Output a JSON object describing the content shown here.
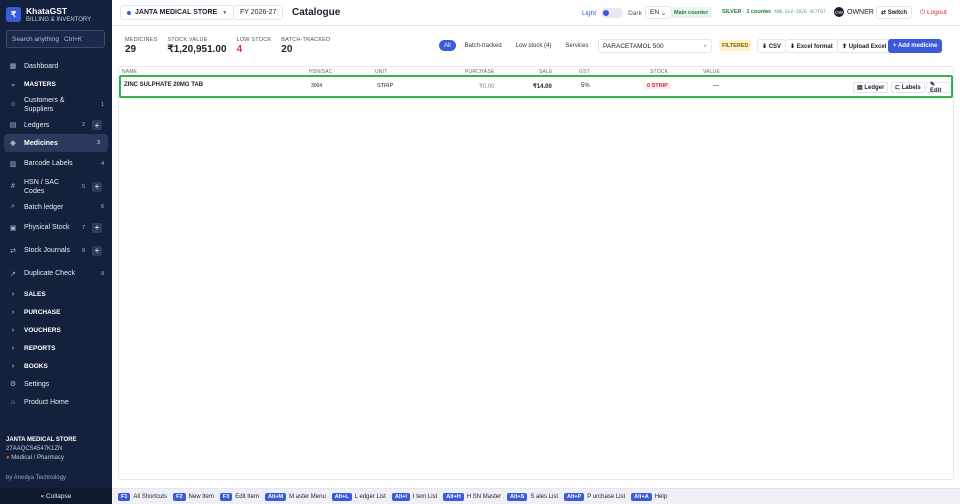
{
  "app": {
    "name": "KhataGST",
    "subtitle": "BILLING & INVENTORY",
    "logo_glyph": "₹"
  },
  "search": {
    "placeholder": "Search anything",
    "shortcut": "Ctrl+K"
  },
  "sidebar": {
    "items": [
      {
        "label": "Dashboard",
        "icon": "dashboard-icon"
      },
      {
        "label": "MASTERS",
        "section": true,
        "icon": "chevron-down-icon"
      },
      {
        "label": "Customers & Suppliers",
        "count": "1",
        "icon": "users-icon"
      },
      {
        "label": "Ledgers",
        "count": "2",
        "plus": true,
        "icon": "book-icon"
      },
      {
        "label": "Medicines",
        "count": "3",
        "active": true,
        "icon": "pill-icon"
      },
      {
        "label": "Barcode Labels",
        "count": "4",
        "icon": "barcode-icon"
      },
      {
        "label": "HSN / SAC Codes",
        "count": "5",
        "plus": true,
        "icon": "hash-icon"
      },
      {
        "label": "Batch ledger",
        "count": "6",
        "icon": "search-icon"
      },
      {
        "label": "Physical Stock",
        "count": "7",
        "plus": true,
        "icon": "box-icon"
      },
      {
        "label": "Stock Journals",
        "count": "8",
        "plus": true,
        "icon": "arrows-icon"
      },
      {
        "label": "Duplicate Check",
        "count": "9",
        "icon": "wand-icon"
      },
      {
        "label": "SALES",
        "section": true,
        "icon": "chevron-right-icon"
      },
      {
        "label": "PURCHASE",
        "section": true,
        "icon": "chevron-right-icon"
      },
      {
        "label": "VOUCHERS",
        "section": true,
        "icon": "chevron-right-icon"
      },
      {
        "label": "REPORTS",
        "section": true,
        "icon": "chevron-right-icon"
      },
      {
        "label": "BOOKS",
        "section": true,
        "icon": "chevron-right-icon"
      },
      {
        "label": "Settings",
        "icon": "gear-icon"
      },
      {
        "label": "Product Home",
        "icon": "home-icon"
      }
    ],
    "plus_glyph": "+",
    "footer": {
      "store": "JANTA MEDICAL STORE",
      "gstin": "27AAQCS4547K1ZN",
      "type": "Medical / Pharmacy",
      "by": "by Anedya Technology",
      "collapse": "« Collapse"
    }
  },
  "topbar": {
    "store": "JANTA MEDICAL STORE",
    "fy": "FY 2026-27",
    "title": "Catalogue",
    "theme_light": "Light",
    "theme_dark": "Dark",
    "lang": "EN",
    "counter": "Main counter",
    "license": "SILVER · 1 counter",
    "license_key": "AND-SLV-2026-4E7F07",
    "avatar": "OW",
    "role": "OWNER",
    "switch": "⇄ Switch",
    "logout": "⏻ Logout"
  },
  "summary": [
    {
      "label": "MEDICINES",
      "value": "29"
    },
    {
      "label": "STOCK VALUE",
      "value": "₹1,20,951.00"
    },
    {
      "label": "LOW STOCK",
      "value": "4",
      "alert": true
    },
    {
      "label": "BATCH-TRACKED",
      "value": "20"
    }
  ],
  "filters": [
    "All",
    "Batch-tracked",
    "Low stock (4)",
    "Services"
  ],
  "active_filter": "All",
  "filter_search": {
    "value": "PARACETAMOL 500",
    "clear": "×"
  },
  "filtered_badge": "FILTERED",
  "actions": {
    "csv": "⬇ CSV",
    "excel": "⬇ Excel format",
    "upload": "⬆ Upload Excel",
    "add": "+ Add medicine"
  },
  "table": {
    "columns": [
      "NAME",
      "HSN/SAC",
      "UNIT",
      "PURCHASE",
      "SALE",
      "GST",
      "STOCK",
      "VALUE"
    ],
    "rows": [
      {
        "name": "ZINC SULPHATE 20MG TAB",
        "hsn": "3004",
        "unit": "STRIP",
        "purchase": "₹0.00",
        "sale": "₹14.00",
        "gst": "5%",
        "stock": "0 STRIP",
        "value": "—"
      }
    ],
    "row_actions": {
      "ledger": "▤ Ledger",
      "labels": "⊏ Labels",
      "edit": "✎ Edit"
    }
  },
  "shortcuts": [
    {
      "key": "F1",
      "label": "All Shortcuts"
    },
    {
      "key": "F2",
      "label": "New Item"
    },
    {
      "key": "F3",
      "label": "Edit Item"
    },
    {
      "key": "Alt+M",
      "label": "M aster Menu"
    },
    {
      "key": "Alt+L",
      "label": "L edger List"
    },
    {
      "key": "Alt+I",
      "label": "I tem List"
    },
    {
      "key": "Alt+H",
      "label": "H SN Master"
    },
    {
      "key": "Alt+S",
      "label": "S ales List"
    },
    {
      "key": "Alt+P",
      "label": "P urchase List"
    },
    {
      "key": "Alt+A",
      "label": "Help"
    }
  ],
  "colors": {
    "sidebar": "#14213d",
    "accent": "#3b5bdb",
    "danger": "#d13438",
    "highlight_row": "#37b24d"
  }
}
